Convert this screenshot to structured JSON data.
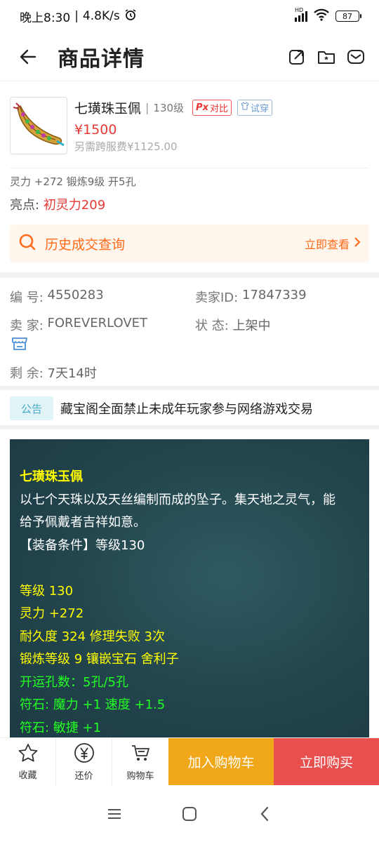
{
  "status_bar": {
    "time": "晚上8:30",
    "net_speed": "4.8K/s",
    "network": "HD",
    "battery": "87"
  },
  "header": {
    "title": "商品详情"
  },
  "product": {
    "name": "七璜珠玉佩",
    "separator": "|",
    "level": "130级",
    "compare_label": "对比",
    "try_label": "试穿",
    "price": "¥1500",
    "cross_fee": "另需跨服费¥1125.00",
    "attributes": "灵力 +272 锻炼9级 开5孔",
    "highlight_label": "亮点:",
    "highlight_value": "初灵力209"
  },
  "history": {
    "label": "历史成交查询",
    "link": "立即查看"
  },
  "meta": {
    "id_label": "编 号:",
    "id_value": "4550283",
    "seller_id_label": "卖家ID:",
    "seller_id_value": "17847339",
    "seller_label": "卖 家:",
    "seller_value": "FOREVERLOVET",
    "state_label": "状 态:",
    "state_value": "上架中",
    "remain_label": "剩 余:",
    "remain_value": "7天14时"
  },
  "notice": {
    "tag": "公告",
    "text": "藏宝阁全面禁止未成年玩家参与网络游戏交易"
  },
  "description": {
    "title": "七璜珠玉佩",
    "lines_white": [
      "以七个天珠以及天丝编制而成的坠子。集天地之灵气，能",
      "给予佩戴者吉祥如意。",
      "【装备条件】等级130"
    ],
    "lines_yellow": [
      "等级 130",
      "灵力 +272",
      "耐久度 324 修理失败 3次",
      "锻炼等级 9 镶嵌宝石 舍利子"
    ],
    "lines_green": [
      "开运孔数：5孔/5孔",
      "符石: 魔力 +1 速度 +1.5",
      "符石: 敏捷 +1"
    ]
  },
  "bottom_bar": {
    "favorite": "收藏",
    "bargain": "还价",
    "cart": "购物车",
    "add_cart": "加入购物车",
    "buy_now": "立即购买"
  },
  "colors": {
    "accent_red": "#e53935",
    "accent_orange": "#ff6a1a",
    "cart_button": "#f0a81a",
    "buy_button": "#e85050",
    "desc_bg": "#22444c"
  }
}
